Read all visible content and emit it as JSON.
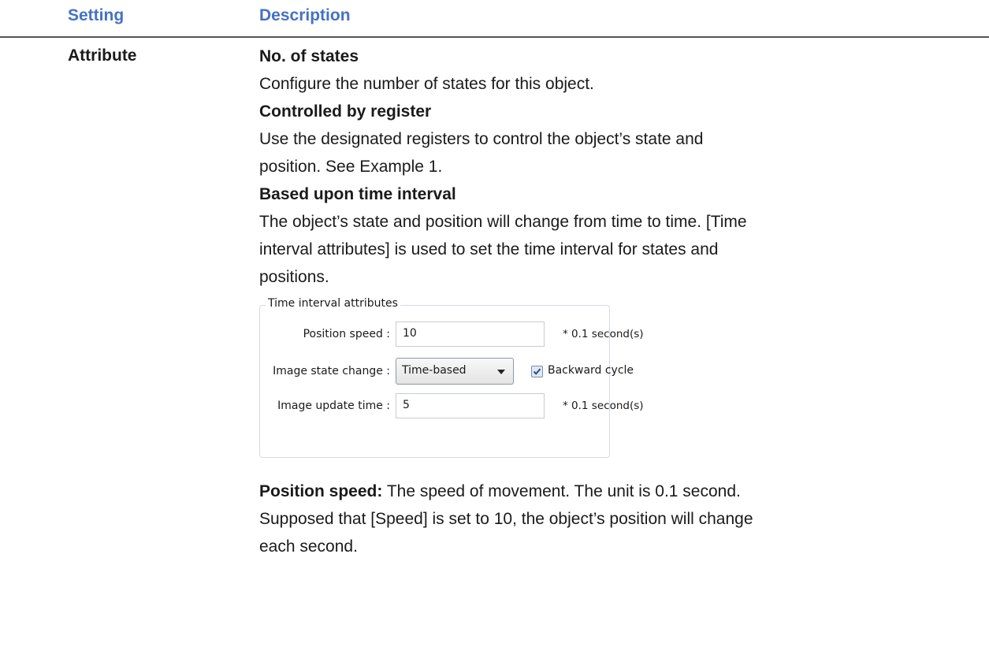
{
  "header": {
    "setting": "Setting",
    "description": "Description"
  },
  "row": {
    "label": "Attribute",
    "paragraphs": [
      {
        "text": "No. of states",
        "bold": true
      },
      {
        "text": "Configure the number of states for this object.",
        "bold": false
      },
      {
        "text": "Controlled by register",
        "bold": true
      },
      {
        "text": "Use the designated registers to control the object’s state and",
        "bold": false
      },
      {
        "text": "position. See Example 1.",
        "bold": false
      },
      {
        "text": "Based upon time interval",
        "bold": true
      },
      {
        "text": "The object’s state and position will change from time to time. [Time",
        "bold": false
      },
      {
        "text": "interval attributes] is used to set the time interval for states and",
        "bold": false
      },
      {
        "text": "positions.",
        "bold": false
      }
    ],
    "after": {
      "bold_lead": "Position speed:",
      "line1_rest": " The speed of movement. The unit is 0.1 second.",
      "line2": "Supposed that [Speed] is set to 10, the object’s position will change",
      "line3": "each second."
    }
  },
  "dialog": {
    "title": "Time interval attributes",
    "position_speed_label": "Position speed :",
    "position_speed_value": "10",
    "position_speed_unit": "* 0.1 second(s)",
    "image_state_label": "Image state change :",
    "image_state_selected": "Time-based",
    "backward_cycle_label": "Backward cycle",
    "backward_cycle_checked": true,
    "image_update_label": "Image update time :",
    "image_update_value": "5",
    "image_update_unit": "* 0.1 second(s)"
  },
  "colors": {
    "header_text": "#4472c4"
  }
}
